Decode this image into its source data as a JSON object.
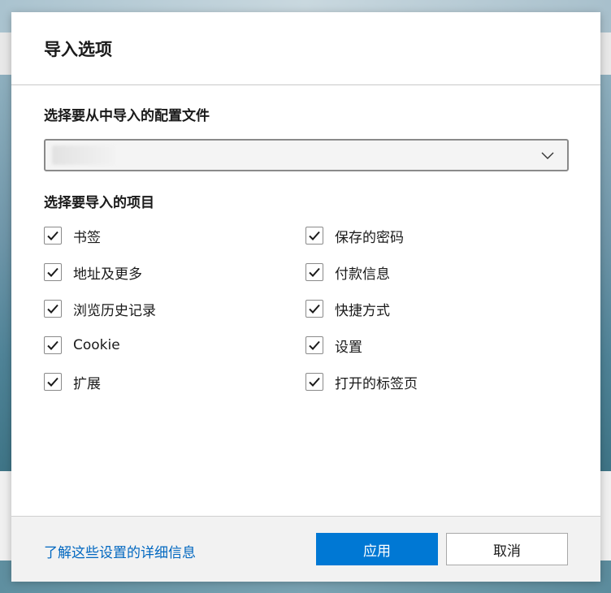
{
  "dialog": {
    "title": "导入选项",
    "profile_section_label": "选择要从中导入的配置文件",
    "profile_select_value": "",
    "items_section_label": "选择要导入的项目",
    "items_left": [
      {
        "label": "书签",
        "checked": true
      },
      {
        "label": "地址及更多",
        "checked": true
      },
      {
        "label": "浏览历史记录",
        "checked": true
      },
      {
        "label": "Cookie",
        "checked": true
      },
      {
        "label": "扩展",
        "checked": true
      }
    ],
    "items_right": [
      {
        "label": "保存的密码",
        "checked": true
      },
      {
        "label": "付款信息",
        "checked": true
      },
      {
        "label": "快捷方式",
        "checked": true
      },
      {
        "label": "设置",
        "checked": true
      },
      {
        "label": "打开的标签页",
        "checked": true
      }
    ]
  },
  "footer": {
    "learn_more_link": "了解这些设置的详细信息",
    "apply_button": "应用",
    "cancel_button": "取消"
  },
  "colors": {
    "accent": "#0078d4",
    "link": "#0067c0"
  },
  "icons": {
    "select_chevron": "chevron-down-icon",
    "checkbox_mark": "checkmark-icon"
  }
}
